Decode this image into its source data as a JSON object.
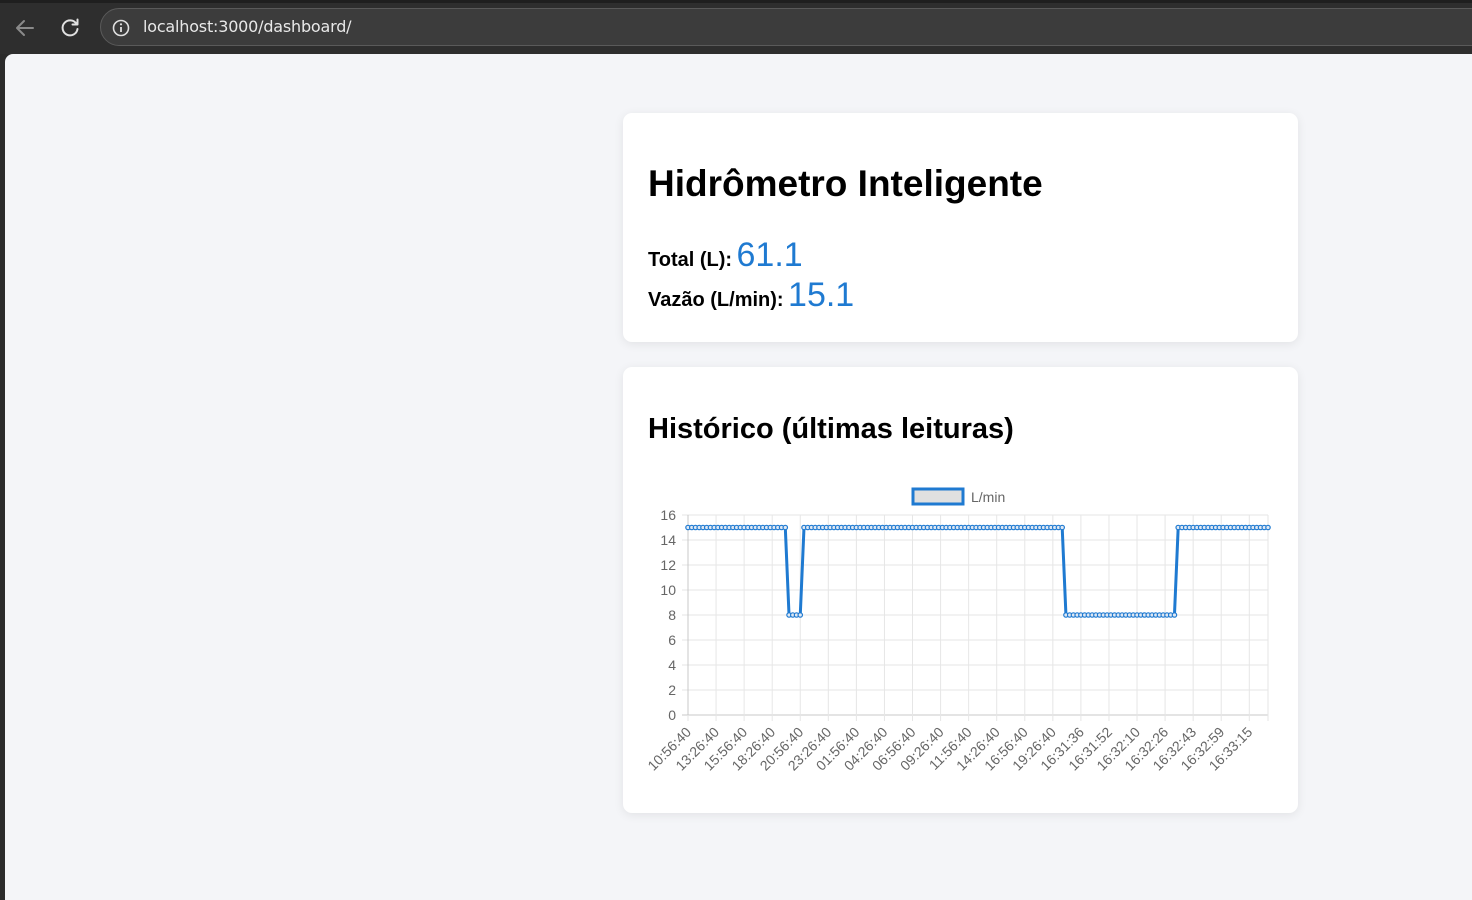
{
  "browser": {
    "url": "localhost:3000/dashboard/"
  },
  "dashboard": {
    "title": "Hidrômetro Inteligente",
    "total_label": "Total (L):",
    "total_value": "61.1",
    "flow_label": "Vazão (L/min):",
    "flow_value": "15.1"
  },
  "history": {
    "title": "Histórico (últimas leituras)"
  },
  "colors": {
    "accent": "#1f7ad1",
    "page_bg": "#f4f5f8"
  },
  "chart_data": {
    "type": "line",
    "legend": [
      "L/min"
    ],
    "legend_position": "top",
    "grid": true,
    "ylim": [
      0,
      16
    ],
    "y_ticks": [
      0,
      2,
      4,
      6,
      8,
      10,
      12,
      14,
      16
    ],
    "x_tick_labels": [
      "10:56:40",
      "13:26:40",
      "15:56:40",
      "18:26:40",
      "20:56:40",
      "23:26:40",
      "01:56:40",
      "04:26:40",
      "06:56:40",
      "09:26:40",
      "11:56:40",
      "14:26:40",
      "16:56:40",
      "19:26:40",
      "16:31:36",
      "16:31:52",
      "16:32:10",
      "16:32:26",
      "16:32:43",
      "16:32:59",
      "16:33:15"
    ],
    "series": [
      {
        "name": "L/min",
        "values": [
          15,
          15,
          15,
          15,
          15,
          15,
          15,
          15,
          15,
          15,
          15,
          15,
          15,
          15,
          15,
          15,
          15,
          15,
          15,
          15,
          15,
          15,
          15,
          15,
          15,
          15,
          15,
          8,
          8,
          8,
          8,
          15,
          15,
          15,
          15,
          15,
          15,
          15,
          15,
          15,
          15,
          15,
          15,
          15,
          15,
          15,
          15,
          15,
          15,
          15,
          15,
          15,
          15,
          15,
          15,
          15,
          15,
          15,
          15,
          15,
          15,
          15,
          15,
          15,
          15,
          15,
          15,
          15,
          15,
          15,
          15,
          15,
          15,
          15,
          15,
          15,
          15,
          15,
          15,
          15,
          15,
          15,
          15,
          15,
          15,
          15,
          15,
          15,
          15,
          15,
          15,
          15,
          15,
          15,
          15,
          15,
          15,
          15,
          15,
          15,
          15,
          8,
          8,
          8,
          8,
          8,
          8,
          8,
          8,
          8,
          8,
          8,
          8,
          8,
          8,
          8,
          8,
          8,
          8,
          8,
          8,
          8,
          8,
          8,
          8,
          8,
          8,
          8,
          8,
          8,
          8,
          15,
          15,
          15,
          15,
          15,
          15,
          15,
          15,
          15,
          15,
          15,
          15,
          15,
          15,
          15,
          15,
          15,
          15,
          15,
          15,
          15,
          15,
          15,
          15,
          15
        ]
      }
    ]
  }
}
